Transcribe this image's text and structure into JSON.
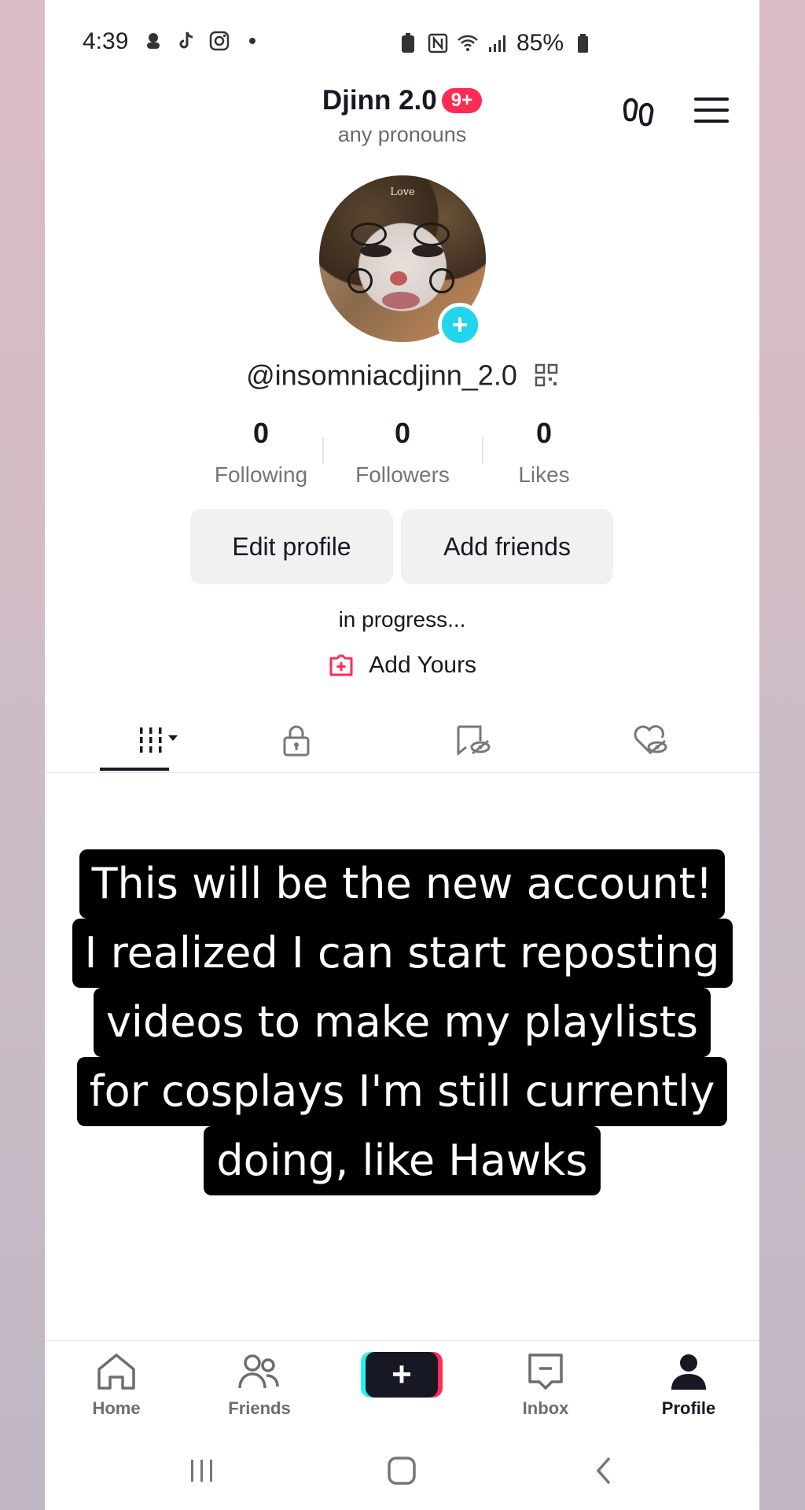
{
  "status_bar": {
    "time": "4:39",
    "battery": "85%"
  },
  "header": {
    "display_name": "Djinn 2.0",
    "notification_badge": "9+",
    "pronouns": "any pronouns"
  },
  "profile": {
    "avatar_text": "Love",
    "username": "@insomniacdjinn_2.0",
    "stats": [
      {
        "value": "0",
        "label": "Following"
      },
      {
        "value": "0",
        "label": "Followers"
      },
      {
        "value": "0",
        "label": "Likes"
      }
    ],
    "buttons": {
      "edit": "Edit profile",
      "add_friends": "Add friends"
    },
    "bio": "in progress...",
    "add_yours": "Add Yours"
  },
  "caption": {
    "lines": [
      "This will be the new account!",
      "I realized I can start reposting",
      "videos to make my playlists",
      "for cosplays I'm still currently",
      "doing, like Hawks"
    ]
  },
  "bottom_nav": {
    "home": "Home",
    "friends": "Friends",
    "inbox": "Inbox",
    "profile": "Profile"
  },
  "colors": {
    "accent_red": "#fe2c55",
    "accent_cyan": "#20d5ec",
    "text_dark": "#161823"
  }
}
